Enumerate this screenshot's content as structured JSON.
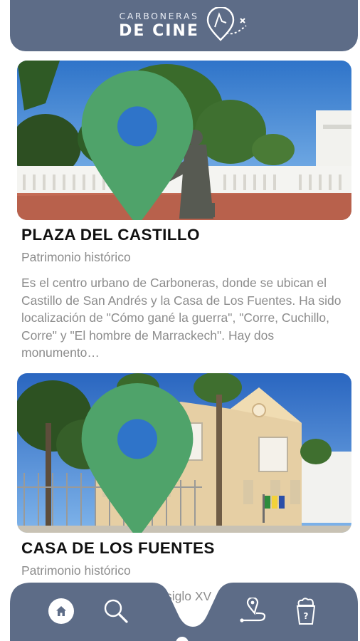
{
  "header": {
    "logo_top": "CARBONERAS",
    "logo_main": "DE CINE"
  },
  "cards": [
    {
      "title": "PLAZA DEL CASTILLO",
      "category": "Patrimonio histórico",
      "description": "Es el centro urbano de Carboneras, donde se ubican el Castillo de San Andrés y la Casa de Los Fuentes. Ha sido localización de \"Cómo gané la guerra\", \"Corre, Cuchillo, Corre\" y \"El hombre de Marrackech\". Hay dos monumento…"
    },
    {
      "title": "CASA DE LOS FUENTES",
      "category": "Patrimonio histórico",
      "description": "siglo XV"
    }
  ],
  "tabbar": {
    "items": [
      "home-icon",
      "search-icon",
      "route-icon",
      "cinema-quiz-icon"
    ]
  },
  "colors": {
    "header_bg": "#5d6c87",
    "pin_green": "#4fa36a",
    "category_text": "#8c8c8c"
  }
}
